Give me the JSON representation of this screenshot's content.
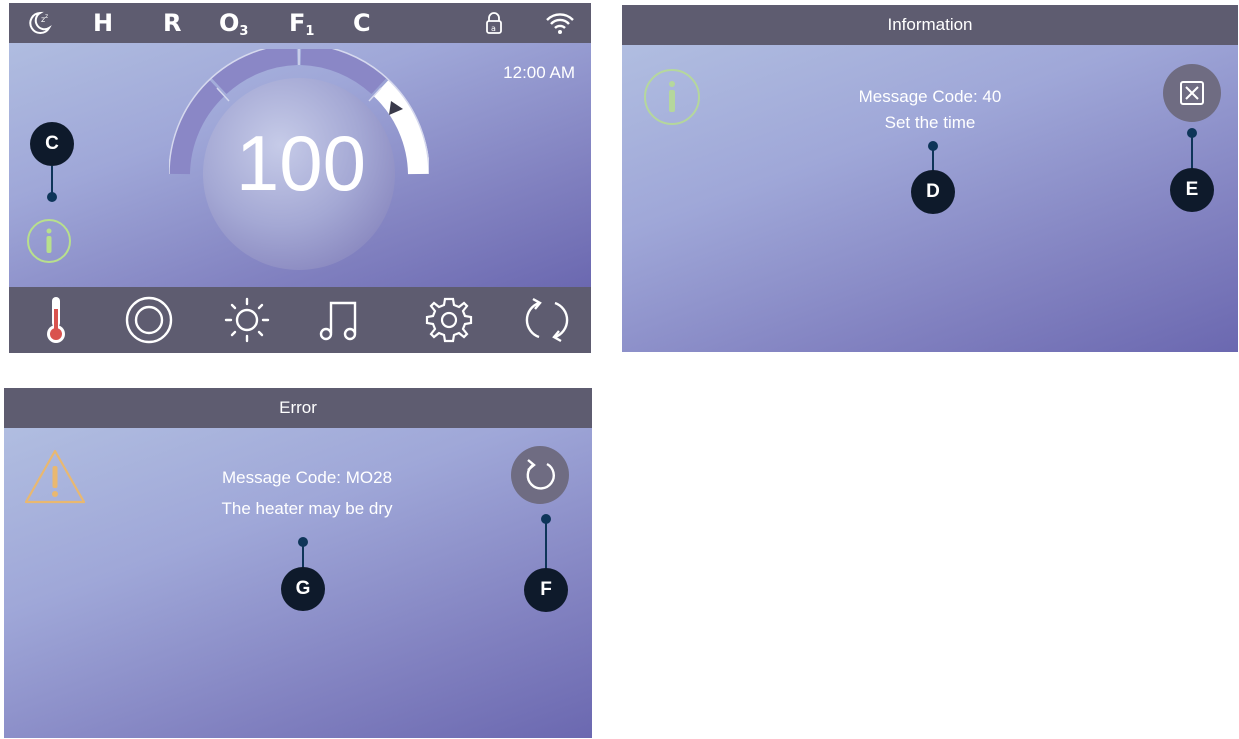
{
  "main_screen": {
    "status_bar": {
      "icons": [
        "sleep-moon-icon",
        "lock-icon",
        "wifi-icon"
      ],
      "letters": [
        "H",
        "R",
        "O",
        "F",
        "C"
      ],
      "o_subscript": "3",
      "f_subscript": "1"
    },
    "clock": "12:00 AM",
    "temperature": "100",
    "dial": {
      "segments_filled": 3,
      "segments_total": 4
    },
    "info_icon": "info-icon",
    "nav_icons": [
      "thermometer-icon",
      "jets-icon",
      "light-icon",
      "music-icon",
      "settings-gear-icon",
      "refresh-icon"
    ]
  },
  "info_dialog": {
    "title": "Information",
    "message_code": "Message Code: 40",
    "message_text": "Set the time",
    "icon": "info-icon",
    "close_icon": "close-x-icon"
  },
  "error_dialog": {
    "title": "Error",
    "message_code": "Message Code: MO28",
    "message_text": "The heater may be dry",
    "icon": "warning-triangle-icon",
    "reset_icon": "reset-icon"
  },
  "callouts": {
    "c": "C",
    "d": "D",
    "e": "E",
    "f": "F",
    "g": "G"
  },
  "colors": {
    "bar": "#5e5c70",
    "gradient_light": "#b4c2e2",
    "gradient_dark": "#6b68b0",
    "info_green": "#b8e08c",
    "warning_orange": "#e9b870",
    "marker": "#0e1a2b",
    "thermometer_red": "#d9534f"
  }
}
